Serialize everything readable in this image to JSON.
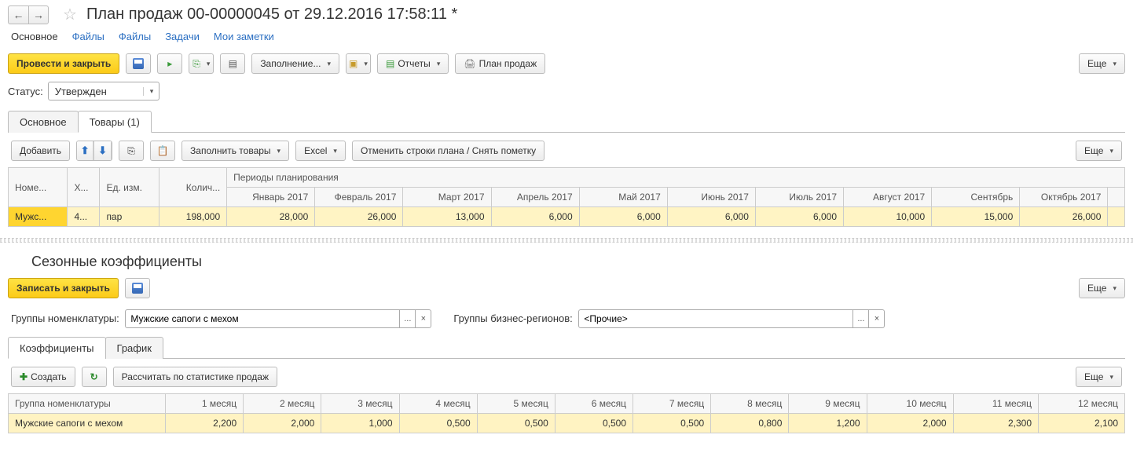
{
  "header": {
    "title": "План продаж 00-00000045 от 29.12.2016 17:58:11 *"
  },
  "nav_links": {
    "main": "Основное",
    "files1": "Файлы",
    "files2": "Файлы",
    "tasks": "Задачи",
    "notes": "Мои заметки"
  },
  "toolbar1": {
    "post_close": "Провести и закрыть",
    "fill": "Заполнение...",
    "reports": "Отчеты",
    "plan": "План продаж",
    "more": "Еще"
  },
  "status": {
    "label": "Статус:",
    "value": "Утвержден"
  },
  "tabs1": {
    "main": "Основное",
    "goods": "Товары (1)"
  },
  "toolbar2": {
    "add": "Добавить",
    "fill_goods": "Заполнить товары",
    "excel": "Excel",
    "cancel": "Отменить строки плана / Снять пометку",
    "more": "Еще"
  },
  "table1": {
    "headers": {
      "nomen": "Номе...",
      "char": "Х...",
      "unit": "Ед. изм.",
      "qty": "Колич...",
      "periods": "Периоды планирования"
    },
    "months": [
      "Январь 2017",
      "Февраль 2017",
      "Март 2017",
      "Апрель 2017",
      "Май 2017",
      "Июнь 2017",
      "Июль 2017",
      "Август 2017",
      "Сентябрь",
      "Октябрь 2017"
    ],
    "row": {
      "nomen": "Мужс...",
      "char": "4...",
      "unit": "пар",
      "qty": "198,000",
      "vals": [
        "28,000",
        "26,000",
        "13,000",
        "6,000",
        "6,000",
        "6,000",
        "6,000",
        "10,000",
        "15,000",
        "26,000"
      ]
    }
  },
  "section2_title": "Сезонные коэффициенты",
  "toolbar3": {
    "save_close": "Записать и закрыть",
    "more": "Еще"
  },
  "fields": {
    "nomen_label": "Группы номенклатуры:",
    "nomen_value": "Мужские сапоги с мехом",
    "region_label": "Группы бизнес-регионов:",
    "region_value": "<Прочие>"
  },
  "tabs2": {
    "coef": "Коэффициенты",
    "chart": "График"
  },
  "toolbar4": {
    "create": "Создать",
    "calc": "Рассчитать по статистике продаж",
    "more": "Еще"
  },
  "coef_table": {
    "headers": [
      "Группа номенклатуры",
      "1 месяц",
      "2 месяц",
      "3 месяц",
      "4 месяц",
      "5 месяц",
      "6 месяц",
      "7 месяц",
      "8 месяц",
      "9 месяц",
      "10 месяц",
      "11 месяц",
      "12 месяц"
    ],
    "row": {
      "name": "Мужские сапоги с мехом",
      "vals": [
        "2,200",
        "2,000",
        "1,000",
        "0,500",
        "0,500",
        "0,500",
        "0,500",
        "0,800",
        "1,200",
        "2,000",
        "2,300",
        "2,100"
      ]
    }
  }
}
